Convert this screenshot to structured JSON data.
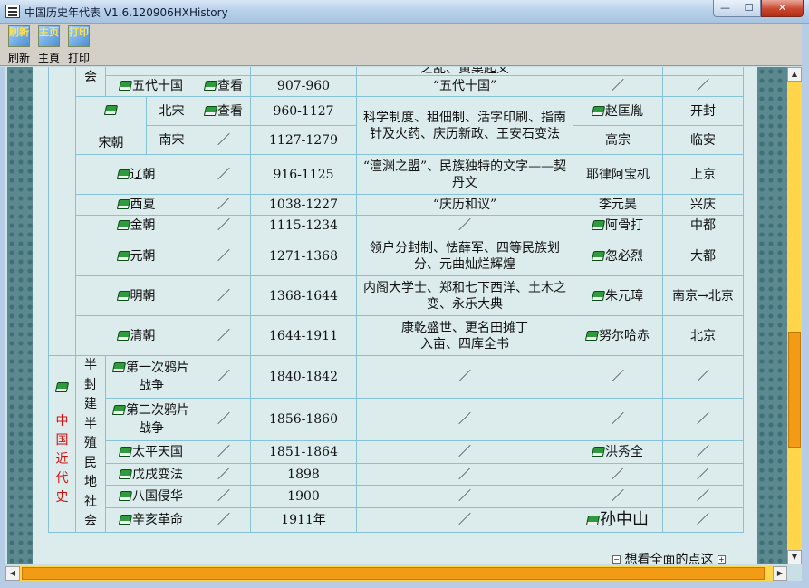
{
  "window": {
    "title": "中国历史年代表 V1.6.120906HXHistory",
    "minimize_glyph": "—",
    "maximize_glyph": "☐",
    "close_glyph": "✕"
  },
  "toolbar": {
    "refresh_label": "刷新",
    "home_label": "主頁",
    "print_label": "打印",
    "refresh_icon_text": "刷新",
    "home_icon_text": "主页",
    "print_icon_text": "打印"
  },
  "table": {
    "group_hui": "会",
    "song_label": "宋朝",
    "modern_label": "中国近代史",
    "semi_label": "半封建半殖民地社会",
    "top_partial_event": "之乱、黄巢起义",
    "rows": [
      {
        "name": "五代十国",
        "view": "查看",
        "years": "907-960",
        "event": "“五代十国”",
        "founder": "／",
        "capital": "／"
      },
      {
        "name": "北宋",
        "view": "查看",
        "years": "960-1127",
        "event": "科学制度、租佃制、活字印刷、指南针及火药、庆历新政、王安石变法",
        "founder": "赵匡胤",
        "capital": "开封"
      },
      {
        "name": "南宋",
        "view": "／",
        "years": "1127-1279",
        "event": "",
        "founder": "高宗",
        "capital": "临安"
      },
      {
        "name": "辽朝",
        "view": "／",
        "years": "916-1125",
        "event": "“澶渊之盟”、民族独特的文字——契丹文",
        "founder": "耶律阿宝机",
        "capital": "上京"
      },
      {
        "name": "西夏",
        "view": "／",
        "years": "1038-1227",
        "event": "“庆历和议”",
        "founder": "李元昊",
        "capital": "兴庆"
      },
      {
        "name": "金朝",
        "view": "／",
        "years": "1115-1234",
        "event": "／",
        "founder": "阿骨打",
        "capital": "中都"
      },
      {
        "name": "元朝",
        "view": "／",
        "years": "1271-1368",
        "event": "领户分封制、怯薛军、四等民族划分、元曲灿烂辉煌",
        "founder": "忽必烈",
        "capital": "大都"
      },
      {
        "name": "明朝",
        "view": "／",
        "years": "1368-1644",
        "event": "内阁大学士、郑和七下西洋、土木之变、永乐大典",
        "founder": "朱元璋",
        "capital": "南京→北京"
      },
      {
        "name": "清朝",
        "view": "／",
        "years": "1644-1911",
        "event": "康乾盛世、更名田摊丁入亩、四库全书",
        "founder": "努尔哈赤",
        "capital": "北京"
      }
    ],
    "modern_rows": [
      {
        "name": "第一次鸦片战争",
        "view": "／",
        "years": "1840-1842",
        "event": "／",
        "founder": "／",
        "capital": "／"
      },
      {
        "name": "第二次鸦片战争",
        "view": "／",
        "years": "1856-1860",
        "event": "／",
        "founder": "／",
        "capital": "／"
      },
      {
        "name": "太平天国",
        "view": "／",
        "years": "1851-1864",
        "event": "／",
        "founder": "洪秀全",
        "capital": "／"
      },
      {
        "name": "戊戌变法",
        "view": "／",
        "years": "1898",
        "event": "／",
        "founder": "／",
        "capital": "／"
      },
      {
        "name": "八国侵华",
        "view": "／",
        "years": "1900",
        "event": "／",
        "founder": "／",
        "capital": "／"
      },
      {
        "name": "辛亥革命",
        "view": "／",
        "years": "1911年",
        "event": "／",
        "founder": "孙中山",
        "capital": "／"
      }
    ]
  },
  "footer": {
    "link_text": "想看全面的点这"
  },
  "colors": {
    "accent_red": "#d21010",
    "scroll_track": "#ffd54a",
    "scroll_thumb": "#f29b14"
  }
}
